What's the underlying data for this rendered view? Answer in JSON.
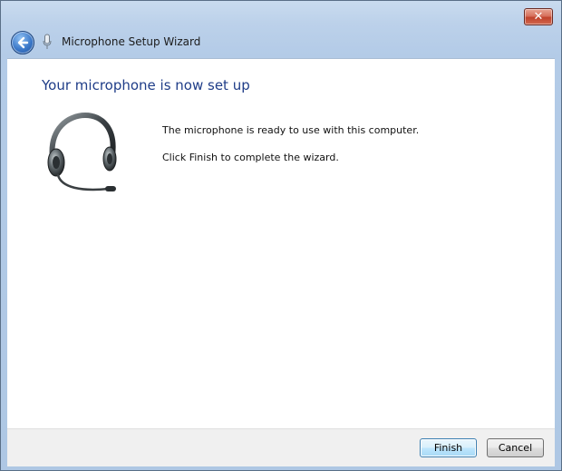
{
  "window": {
    "title": "Microphone Setup Wizard",
    "close_glyph": "✕"
  },
  "icons": {
    "back": "back-arrow-icon",
    "microphone": "microphone-icon",
    "headset": "headset-icon"
  },
  "content": {
    "heading": "Your microphone is now set up",
    "message_ready": "The microphone is ready to use with this computer.",
    "message_finish": "Click Finish to complete the wizard."
  },
  "footer": {
    "finish_label": "Finish",
    "cancel_label": "Cancel"
  },
  "colors": {
    "heading": "#1f3d88",
    "frame": "#b3cbe7",
    "close_button": "#c0432c"
  }
}
